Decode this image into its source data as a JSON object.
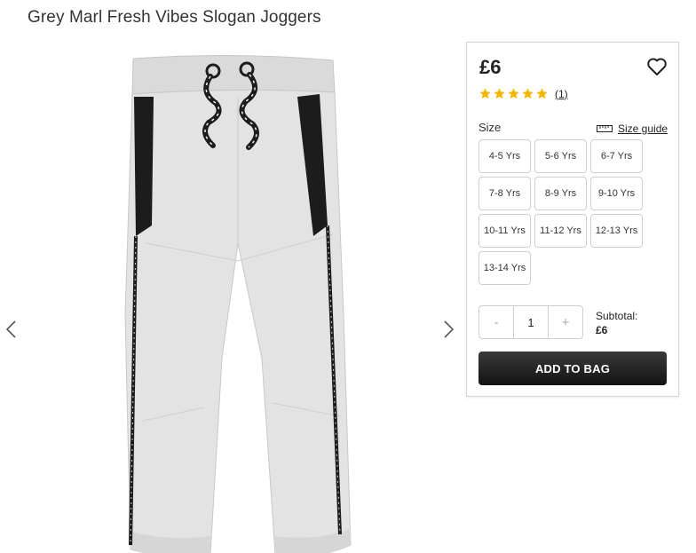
{
  "product": {
    "title": "Grey Marl Fresh Vibes Slogan Joggers",
    "price": "£6",
    "rating": {
      "stars": 5,
      "count_label": "(1)"
    },
    "star_color": "#f5b700"
  },
  "gallery": {
    "prev_icon": "chevron-left-icon",
    "next_icon": "chevron-right-icon"
  },
  "size": {
    "label": "Size",
    "guide_label": "Size guide",
    "guide_icon": "ruler-icon",
    "options": [
      "4-5 Yrs",
      "5-6 Yrs",
      "6-7 Yrs",
      "7-8 Yrs",
      "8-9 Yrs",
      "9-10 Yrs",
      "10-11 Yrs",
      "11-12 Yrs",
      "12-13 Yrs",
      "13-14 Yrs"
    ]
  },
  "quantity": {
    "decrement_label": "-",
    "value": "1",
    "increment_label": "+"
  },
  "subtotal": {
    "label": "Subtotal:",
    "amount": "£6"
  },
  "actions": {
    "add_to_bag_label": "ADD TO BAG",
    "wishlist_icon": "heart-icon"
  }
}
